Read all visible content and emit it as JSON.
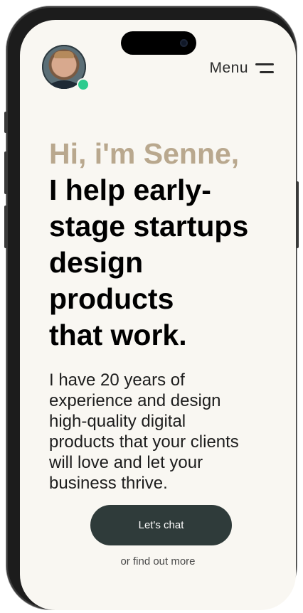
{
  "header": {
    "menu_label": "Menu",
    "status_color": "#2ecb8e"
  },
  "hero": {
    "greeting": "Hi, i'm Senne,",
    "tagline_lines": [
      "I help early-",
      "stage startups",
      "design",
      "products",
      "that work."
    ],
    "intro_lines": [
      "I have 20 years of",
      "experience and design",
      "high-quality digital",
      "products that your clients",
      "will love and let your",
      "business thrive."
    ],
    "cta_label": "Let's chat",
    "secondary_link": "or find out more"
  },
  "colors": {
    "accent": "#b9a88e",
    "button": "#2f3b3a",
    "background": "#f9f7f2"
  },
  "icons": {
    "menu": "hamburger-icon",
    "avatar": "user-photo"
  }
}
